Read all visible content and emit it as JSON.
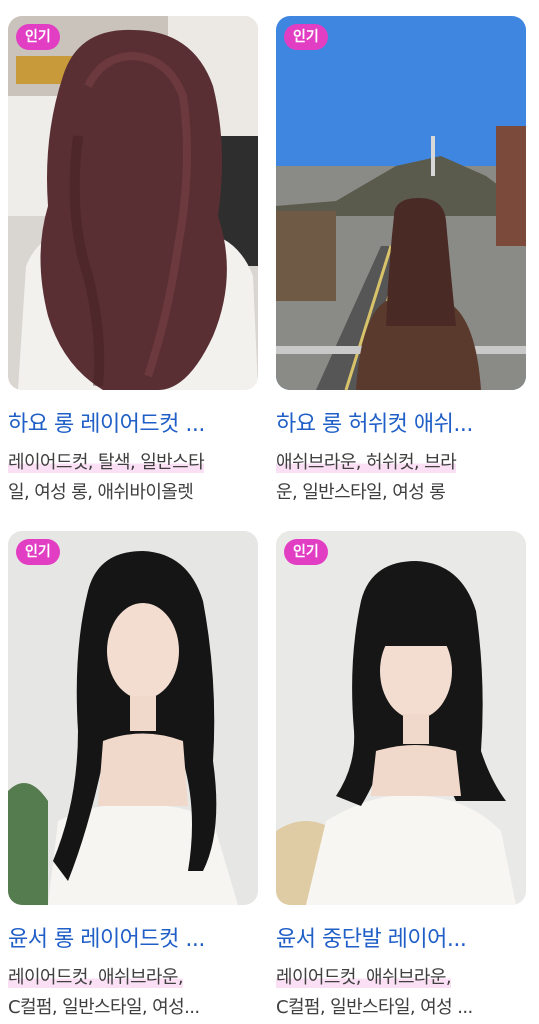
{
  "badge_label": "인기",
  "cards": [
    {
      "title": "하요 롱 레이어드컷 ...",
      "tags_line1": "레이어드컷, 탈색, 일반스타",
      "tags_line2": "일, 여성 롱, 애쉬바이올렛",
      "image_alt": "long wavy hair, back view"
    },
    {
      "title": "하요 롱 허쉬컷 애쉬...",
      "tags_line1": "애쉬브라운, 허쉬컷, 브라",
      "tags_line2": "운, 일반스타일, 여성 롱",
      "image_alt": "long hair, back view on bridge"
    },
    {
      "title": "윤서 롱 레이어드컷 ...",
      "tags_line1": "레이어드컷, 애쉬브라운,",
      "tags_line2": "C컬펌, 일반스타일, 여성...",
      "image_alt": "long layered black hair"
    },
    {
      "title": "윤서 중단발 레이어...",
      "tags_line1": "레이어드컷, 애쉬브라운,",
      "tags_line2": "C컬펌, 일반스타일, 여성 ...",
      "image_alt": "medium layered black hair with bangs"
    }
  ],
  "colors": {
    "badge": "#e13ec4",
    "title": "#1f5fc7",
    "tag_highlight": "#fbe0f5"
  }
}
